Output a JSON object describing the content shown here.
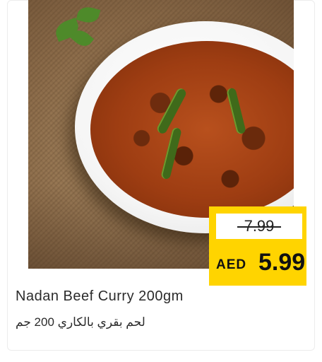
{
  "product": {
    "name_en": "Nadan Beef Curry 200gm",
    "name_ar": "لحم بقري بالكاري 200 جم"
  },
  "price": {
    "old": "7.99",
    "currency": "AED",
    "new": "5.99"
  },
  "colors": {
    "price_tag": "#ffd400",
    "text": "#2b2b2b"
  }
}
